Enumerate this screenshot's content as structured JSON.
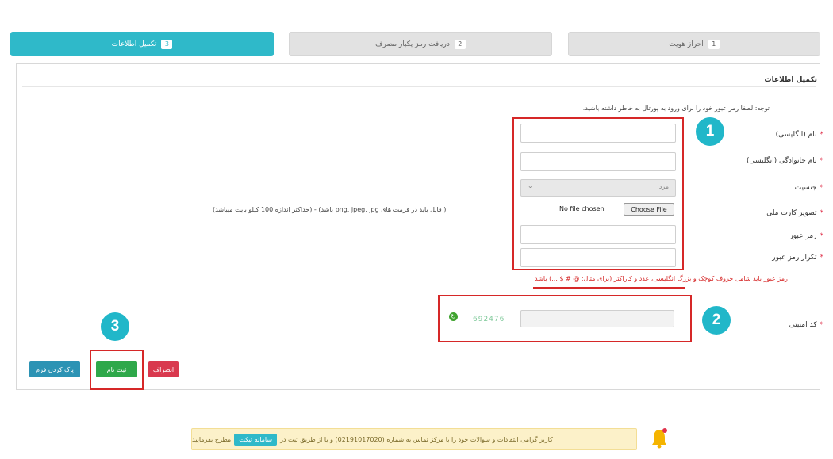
{
  "steps": [
    {
      "num": "1",
      "label": "احراز هویت"
    },
    {
      "num": "2",
      "label": "دریافت رمز یکبار مصرف"
    },
    {
      "num": "3",
      "label": "تکمیل اطلاعات"
    }
  ],
  "form": {
    "title": "تکمیل اطلاعات",
    "note": "توجه: لطفا رمز عبور خود را برای ورود به پورتال به خاطر داشته باشید.",
    "fields": {
      "first_name": "نام (انگلیسی)",
      "last_name": "نام خانوادگی (انگلیسی)",
      "gender": "جنسیت",
      "id_card": "تصویر کارت ملی",
      "password": "رمز عبور",
      "password_repeat": "تکرار رمز عبور",
      "captcha": "کد امنیتی"
    },
    "gender_value": "مرد",
    "file_no_file": "No file chosen",
    "file_button": "Choose File",
    "file_hint": "( فایل باید در فرمت های png, jpeg, jpg باشد) - (حداکثر اندازه 100 کیلو بایت میباشد)",
    "password_hint": "رمز عبور باید شامل حروف کوچک و بزرگ انگلیسی، عدد و کاراکتر (برای مثال: @ # $ ...) باشد",
    "captcha_value": "692476"
  },
  "buttons": {
    "cancel": "انصراف",
    "submit": "ثبت نام",
    "clear": "پاک کردن فرم"
  },
  "annotations": {
    "one": "1",
    "two": "2",
    "three": "3"
  },
  "notice": {
    "text_start": "کاربر گرامی انتقادات و سوالات خود را با مرکز تماس به شماره (02191017020) و یا از طریق ثبت در",
    "link": "سامانه تیکت",
    "text_end": "مطرح بفرمایید"
  },
  "colors": {
    "accent": "#2fb9c9",
    "required": "#e0314b",
    "annotation_red": "#d62828",
    "submit_green": "#2ea84a",
    "cancel_red": "#d9394e",
    "clear_blue": "#2c93b4"
  }
}
